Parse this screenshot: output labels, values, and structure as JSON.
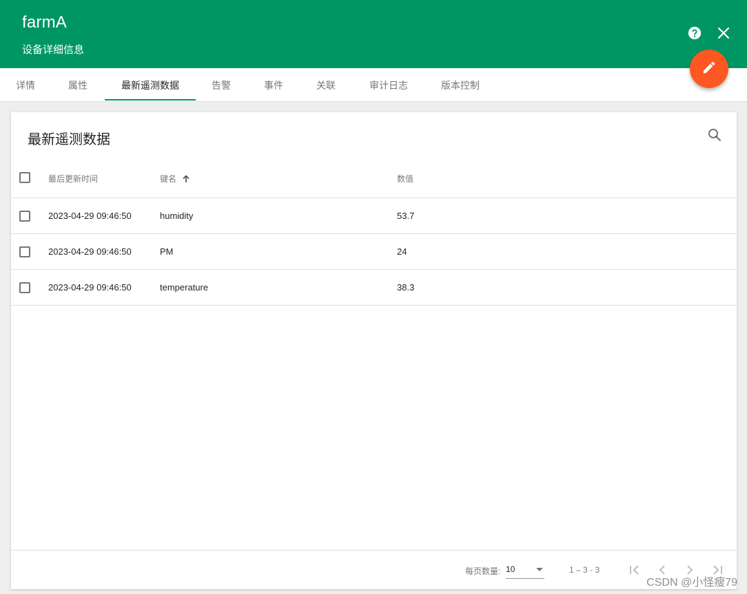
{
  "header": {
    "title": "farmA",
    "subtitle": "设备详细信息",
    "color": "#009664",
    "actions": [
      "help-icon",
      "close-icon"
    ]
  },
  "fab": {
    "icon": "pencil-icon",
    "color": "#ff5722"
  },
  "tabs": [
    {
      "label": "详情"
    },
    {
      "label": "属性"
    },
    {
      "label": "最新遥测数据",
      "active": true
    },
    {
      "label": "告警"
    },
    {
      "label": "事件"
    },
    {
      "label": "关联"
    },
    {
      "label": "审计日志"
    },
    {
      "label": "版本控制"
    }
  ],
  "card": {
    "title": "最新遥测数据",
    "search_icon": "search-icon"
  },
  "table": {
    "columns": {
      "last_update": "最后更新时间",
      "key": "键名",
      "value": "数值"
    },
    "sort_icon": "arrow-up-icon",
    "rows": [
      {
        "time": "2023-04-29 09:46:50",
        "key": "humidity",
        "value": "53.7"
      },
      {
        "time": "2023-04-29 09:46:50",
        "key": "PM",
        "value": "24"
      },
      {
        "time": "2023-04-29 09:46:50",
        "key": "temperature",
        "value": "38.3"
      }
    ]
  },
  "pagination": {
    "page_size_label": "每页数量:",
    "page_size": "10",
    "range": "1 – 3 - 3"
  },
  "watermark": "CSDN @小怪瘦79"
}
